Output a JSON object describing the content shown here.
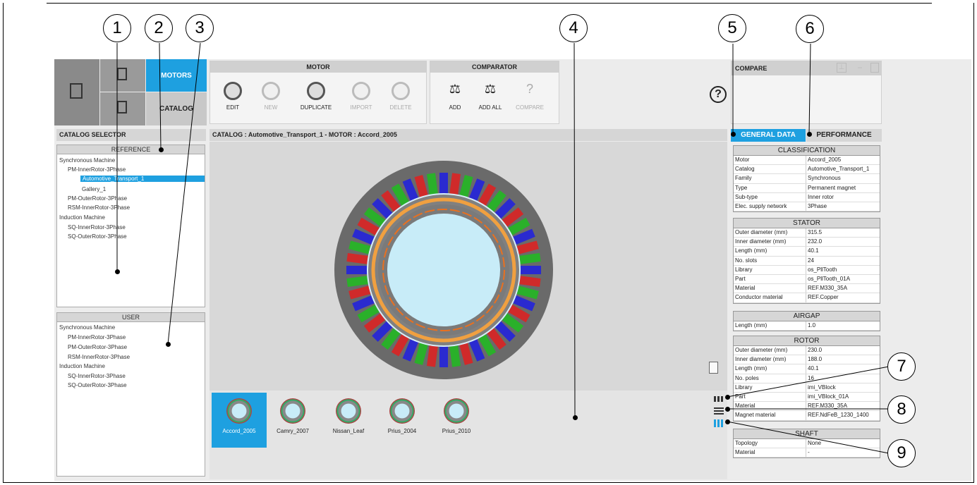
{
  "callouts": [
    "1",
    "2",
    "3",
    "4",
    "5",
    "6",
    "7",
    "8",
    "9"
  ],
  "tabs": {
    "motors": "MOTORS",
    "catalog": "CATALOG"
  },
  "motor_group": {
    "title": "MOTOR",
    "buttons": [
      "EDIT",
      "NEW",
      "DUPLICATE",
      "IMPORT",
      "DELETE"
    ]
  },
  "comparator_group": {
    "title": "COMPARATOR",
    "buttons": [
      "ADD",
      "ADD ALL",
      "COMPARE"
    ]
  },
  "help": "?",
  "compare_panel": {
    "title": "COMPARE"
  },
  "catalog_selector": "CATALOG SELECTOR",
  "breadcrumb": "CATALOG : Automotive_Transport_1  -  MOTOR : Accord_2005",
  "reference_tree": {
    "title": "REFERENCE",
    "nodes": [
      "Synchronous Machine",
      "PM-InnerRotor-3Phase",
      "Automotive_Transport_1",
      "Gallery_1",
      "PM-OuterRotor-3Phase",
      "RSM-InnerRotor-3Phase",
      "Induction Machine",
      "SQ-InnerRotor-3Phase",
      "SQ-OuterRotor-3Phase"
    ]
  },
  "user_tree": {
    "title": "USER",
    "nodes": [
      "Synchronous Machine",
      "PM-InnerRotor-3Phase",
      "PM-OuterRotor-3Phase",
      "RSM-InnerRotor-3Phase",
      "Induction Machine",
      "SQ-InnerRotor-3Phase",
      "SQ-OuterRotor-3Phase"
    ]
  },
  "motors": [
    "Accord_2005",
    "Camry_2007",
    "Nissan_Leaf",
    "Prius_2004",
    "Prius_2010"
  ],
  "right_tabs": {
    "general": "GENERAL DATA",
    "performance": "PERFORMANCE"
  },
  "classification": {
    "title": "CLASSIFICATION",
    "rows": [
      [
        "Motor",
        "Accord_2005"
      ],
      [
        "Catalog",
        "Automotive_Transport_1"
      ],
      [
        "Family",
        "Synchronous"
      ],
      [
        "Type",
        "Permanent magnet"
      ],
      [
        "Sub-type",
        "Inner rotor"
      ],
      [
        "Elec. supply network",
        "3Phase"
      ]
    ]
  },
  "stator": {
    "title": "STATOR",
    "rows": [
      [
        "Outer diameter (mm)",
        "315.5"
      ],
      [
        "Inner diameter (mm)",
        "232.0"
      ],
      [
        "Length (mm)",
        "40.1"
      ],
      [
        "No. slots",
        "24"
      ],
      [
        "Library",
        "os_PllTooth"
      ],
      [
        "Part",
        "os_PllTooth_01A"
      ],
      [
        "Material",
        "REF.M330_35A"
      ],
      [
        "Conductor material",
        "REF.Copper"
      ]
    ]
  },
  "airgap": {
    "title": "AIRGAP",
    "rows": [
      [
        "Length (mm)",
        "1.0"
      ]
    ]
  },
  "rotor": {
    "title": "ROTOR",
    "rows": [
      [
        "Outer diameter (mm)",
        "230.0"
      ],
      [
        "Inner diameter (mm)",
        "188.0"
      ],
      [
        "Length (mm)",
        "40.1"
      ],
      [
        "No. poles",
        "16"
      ],
      [
        "Library",
        "imi_VBlock"
      ],
      [
        "Part",
        "imi_VBlock_01A"
      ],
      [
        "Material",
        "REF.M330_35A"
      ],
      [
        "Magnet material",
        "REF.NdFeB_1230_1400"
      ]
    ]
  },
  "shaft": {
    "title": "SHAFT",
    "rows": [
      [
        "Topology",
        "None"
      ],
      [
        "Material",
        "-"
      ]
    ]
  }
}
